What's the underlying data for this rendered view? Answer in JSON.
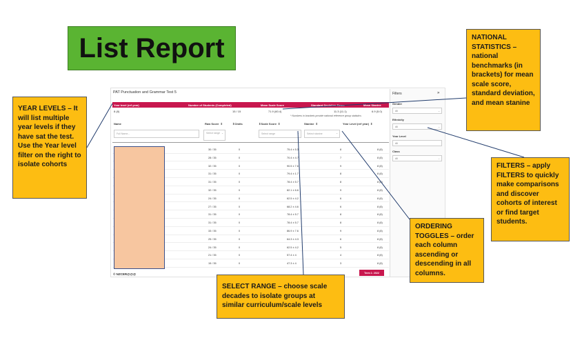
{
  "title": "List Report",
  "callouts": {
    "year_levels": "YEAR LEVELS – It will list multiple year levels if they have sat the test. Use the Year level filter on the right to isolate cohorts",
    "national": "NATIONAL STATISTICS – national benchmarks (in brackets) for mean scale score, standard deviation, and mean stanine",
    "filters": "FILTERS – apply FILTERS to quickly make comparisons and discover cohorts of interest or find target students.",
    "ordering": "ORDERING TOGGLES – order each column ascending or descending in all columns.",
    "select_range": "SELECT RANGE – choose scale decades to isolate groups at similar curriculum/scale levels"
  },
  "report": {
    "test_title": "PAT Punctuation and Grammar Test 5",
    "national_headers": {
      "year_level": "Year level (ref year)",
      "num_students": "Number of Students (Completed)",
      "mean_scale": "Mean Scale Score",
      "sd": "Standard Deviation Score",
      "mean_stanine": "Mean Stanine"
    },
    "national_values": {
      "year_level": "8 (8)",
      "num_students": "15 / 15",
      "mean_scale": "71.9 (60.4)",
      "sd": "11.3 (11.1)",
      "mean_stanine": "6.9 (5.0)"
    },
    "footnote": "* Numbers in brackets provide national reference group statistics",
    "columns": {
      "name": "Name",
      "raw_score": "Raw Score",
      "omits": "Omits",
      "scale_score": "Scale Score",
      "stanine": "Stanine",
      "year_level": "Year Level (ref year)"
    },
    "inputs": {
      "name_placeholder": "Full Name...",
      "raw_range": "Select range",
      "scale_range": "Select range",
      "stanine_range": "Select stanine"
    },
    "rows": [
      {
        "raw": "30 / 35",
        "omits": "0",
        "scale": "75.4 ± 5.3",
        "stanine": "8",
        "year": "8 (8)"
      },
      {
        "raw": "28 / 35",
        "omits": "0",
        "scale": "70.4 ± 4.7",
        "stanine": "7",
        "year": "8 (8)"
      },
      {
        "raw": "32 / 35",
        "omits": "0",
        "scale": "90.5 ± 7.6",
        "stanine": "9",
        "year": "8 (8)"
      },
      {
        "raw": "31 / 35",
        "omits": "0",
        "scale": "79.4 ± 1.7",
        "stanine": "8",
        "year": "8 (8)"
      },
      {
        "raw": "31 / 35",
        "omits": "0",
        "scale": "78.4 ± 5.7",
        "stanine": "8",
        "year": "8 (8)"
      },
      {
        "raw": "32 / 35",
        "omits": "0",
        "scale": "82.1 ± 6.6",
        "stanine": "9",
        "year": "8 (8)"
      },
      {
        "raw": "24 / 35",
        "omits": "0",
        "scale": "62.5 ± 4.2",
        "stanine": "6",
        "year": "8 (8)"
      },
      {
        "raw": "27 / 35",
        "omits": "0",
        "scale": "68.2 ± 4.6",
        "stanine": "6",
        "year": "8 (8)"
      },
      {
        "raw": "31 / 35",
        "omits": "0",
        "scale": "78.4 ± 5.7",
        "stanine": "8",
        "year": "8 (8)"
      },
      {
        "raw": "31 / 35",
        "omits": "0",
        "scale": "78.4 ± 5.7",
        "stanine": "8",
        "year": "8 (8)"
      },
      {
        "raw": "33 / 35",
        "omits": "0",
        "scale": "86.9 ± 7.6",
        "stanine": "9",
        "year": "8 (8)"
      },
      {
        "raw": "25 / 35",
        "omits": "0",
        "scale": "64.3 ± 4.3",
        "stanine": "6",
        "year": "8 (8)"
      },
      {
        "raw": "24 / 35",
        "omits": "0",
        "scale": "62.5 ± 4.2",
        "stanine": "5",
        "year": "8 (8)"
      },
      {
        "raw": "21 / 35",
        "omits": "0",
        "scale": "57.4 ± 4",
        "stanine": "4",
        "year": "8 (8)"
      },
      {
        "raw": "15 / 35",
        "omits": "0",
        "scale": "47.3 ± 4",
        "stanine": "3",
        "year": "8 (8)"
      }
    ],
    "logo": "© NZCER@@@",
    "term_button": "Term 1: 2022"
  },
  "filters_panel": {
    "title": "Filters",
    "collapse": "»",
    "gender_label": "Gender",
    "gender_value": "All",
    "ethnicity_label": "Ethnicity",
    "ethnicity_value": "All",
    "year_label": "Year Level",
    "year_value": "All",
    "class_label": "Class",
    "class_value": "All"
  },
  "colors": {
    "title_green": "#5ab432",
    "callout_orange": "#fdbd12",
    "accent_crimson": "#c8174e",
    "name_block": "#f7c6a0"
  }
}
